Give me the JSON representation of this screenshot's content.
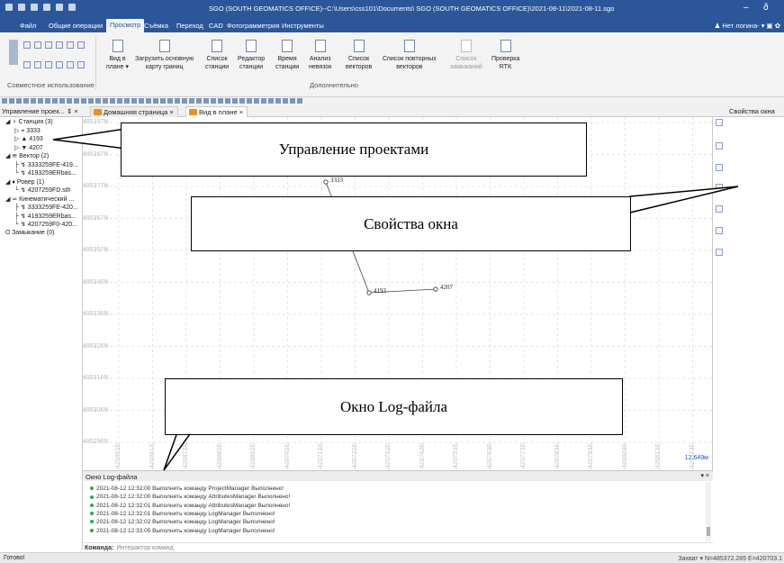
{
  "window": {
    "title": "SGO (SOUTH GEOMATICS OFFICE)--C:\\Users\\css101\\Documents\\ SGO (SOUTH GEOMATICS OFFICE)\\2021-08-11\\2021-08-11.sgo",
    "minimize": "–",
    "restore": "ð"
  },
  "menu": {
    "tabs": [
      "Файл",
      "Общие операции",
      "Просмотр",
      "Съёмка",
      "Переход",
      "CAD",
      "Фотограмметрия",
      "Инструменты"
    ],
    "active_index": 2,
    "login": "♟ Нет логина- ▾ ▣ ✿"
  },
  "ribbon": {
    "left_group_label": "Совместное использование",
    "buttons": [
      {
        "label": "Вид в\nплане ▾",
        "enabled": true
      },
      {
        "label": "Загрузить основную\nкарту границ",
        "enabled": true
      },
      {
        "label": "Список\nстанции",
        "enabled": true
      },
      {
        "label": "Редактор\nстанции",
        "enabled": true
      },
      {
        "label": "Время\nстанции",
        "enabled": true
      },
      {
        "label": "Анализ\nневязок",
        "enabled": true
      },
      {
        "label": "Список\nвекторов",
        "enabled": true
      },
      {
        "label": "Список повторных\nвекторов",
        "enabled": true
      },
      {
        "label": "Список\nзамыканий",
        "enabled": false
      },
      {
        "label": "Проверка\nRTK",
        "enabled": true
      }
    ],
    "group_label": "Дополнительно"
  },
  "panels": {
    "left_title": "Управление проек... ⇕ ×",
    "tabs": [
      {
        "label": "Домашняя страница  ×",
        "active": false
      },
      {
        "label": "Вид в плане  ×",
        "active": true
      }
    ],
    "right_title": "Свойства окна"
  },
  "tree": [
    {
      "label": "◢  ♀ Станция (3)",
      "indent": 0,
      "color": "#333"
    },
    {
      "label": "▷  ⌖ 3333",
      "indent": 1,
      "color": "#333"
    },
    {
      "label": "▷  ▲ 4193",
      "indent": 1,
      "color": "#333"
    },
    {
      "label": "▷  ▼ 4207",
      "indent": 1,
      "color": "#333"
    },
    {
      "label": "◢  ≋ Вектор (2)",
      "indent": 0,
      "color": "#333"
    },
    {
      "label": "├ ↯ 3333259FE-419...",
      "indent": 1,
      "color": "#333"
    },
    {
      "label": "└ ↯ 4193259ERbas...",
      "indent": 1,
      "color": "#333"
    },
    {
      "label": "◢  ♦ Ровер (1)",
      "indent": 0,
      "color": "#333"
    },
    {
      "label": "└ ↯ 4207259FD.sth",
      "indent": 1,
      "color": "#333"
    },
    {
      "label": "◢  ≂ Кинематический ...",
      "indent": 0,
      "color": "#333"
    },
    {
      "label": "├ ↯ 3333259FE-420...",
      "indent": 1,
      "color": "#333"
    },
    {
      "label": "├ ↯ 4193259ERbas...",
      "indent": 1,
      "color": "#333"
    },
    {
      "label": "└ ↯ 4207259F0-420...",
      "indent": 1,
      "color": "#333"
    },
    {
      "label": "Ɑ Замыкание (0)",
      "indent": 0,
      "color": "#333"
    }
  ],
  "plan": {
    "y_labels": [
      "485397N",
      "485387N",
      "485377N",
      "485367N",
      "485357N",
      "485346N",
      "485336N",
      "485326N",
      "485316N",
      "485306N",
      "485296N"
    ],
    "x_labels": [
      "420851E",
      "420861E",
      "420872E",
      "420882E",
      "420892E",
      "420702E",
      "420712E",
      "420722E",
      "420732E",
      "420742E",
      "420753E",
      "420763E",
      "420773E",
      "420783E",
      "420793E",
      "420803E",
      "420813E",
      "420823E"
    ],
    "points": [
      {
        "name": "3333"
      },
      {
        "name": "4193"
      },
      {
        "name": "4207"
      }
    ],
    "scale": "12.649м"
  },
  "log": {
    "title": "Окно Log-файла",
    "pin": "▾ ×",
    "lines": [
      "2021-08-12 12:32:00  Выполнить команду ProjectManager Выполнено!",
      "2021-08-12 12:32:00  Выполнить команду AttributesManager Выполнено!",
      "2021-08-12 12:32:01  Выполнить команду AttributesManager Выполнено!",
      "2021-08-12 12:32:01  Выполнить команду LogManager Выполнено!",
      "2021-08-12 12:32:02  Выполнить команду LogManager Выполнено!",
      "2021-08-12 12:33:05  Выполнить команду LogManager Выполнено!"
    ]
  },
  "command": {
    "label": "Команда:",
    "placeholder": "Интерактор команд"
  },
  "status": {
    "left": "Готово!",
    "right": "Захват ▾  N=485372.285  E=420703.1"
  },
  "callouts": [
    {
      "text": "Управление проектами"
    },
    {
      "text": "Свойства окна"
    },
    {
      "text": "Окно Log-файла"
    }
  ]
}
